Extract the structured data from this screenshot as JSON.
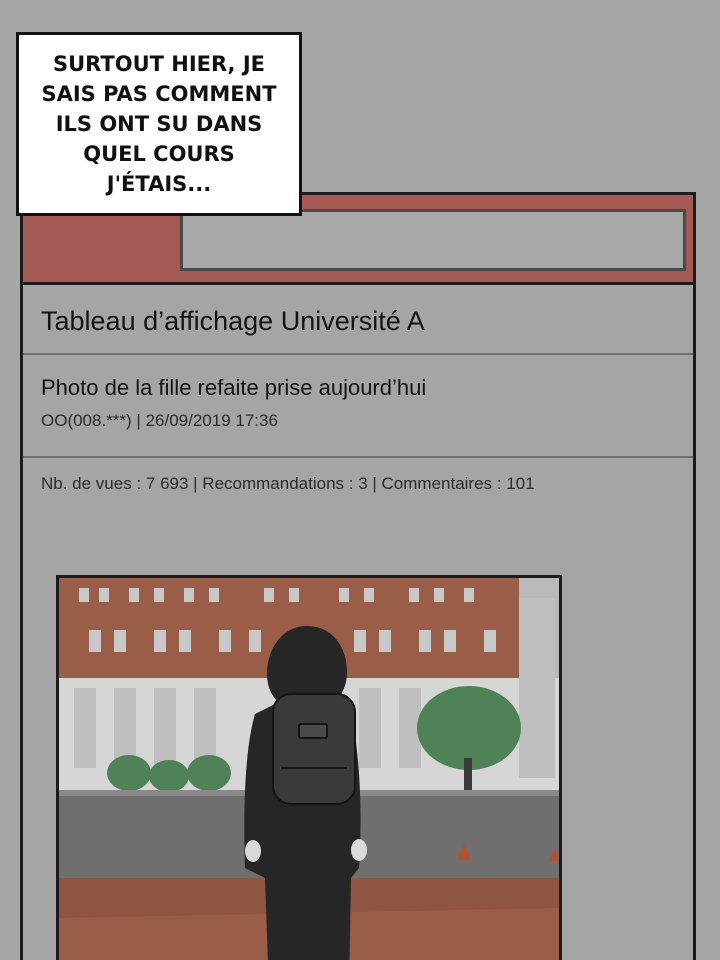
{
  "speech_bubble": {
    "lines": [
      "SURTOUT HIER, JE",
      "SAIS PAS COMMENT",
      "ILS ONT SU DANS",
      "QUEL COURS",
      "J'ÉTAIS..."
    ]
  },
  "board": {
    "title": "Tableau d’affichage Université A"
  },
  "post": {
    "title": "Photo de la fille refaite prise aujourd’hui",
    "meta": "OO(008.***) | 26/09/2019 17:36",
    "stats": "Nb. de vues : 7 693 | Recommandations : 3 | Commentaires : 101"
  },
  "colors": {
    "header_accent": "#a65a56",
    "frame_border": "#1c1c1c"
  },
  "photo": {
    "icon": "photo-of-hooded-person-with-backpack"
  }
}
